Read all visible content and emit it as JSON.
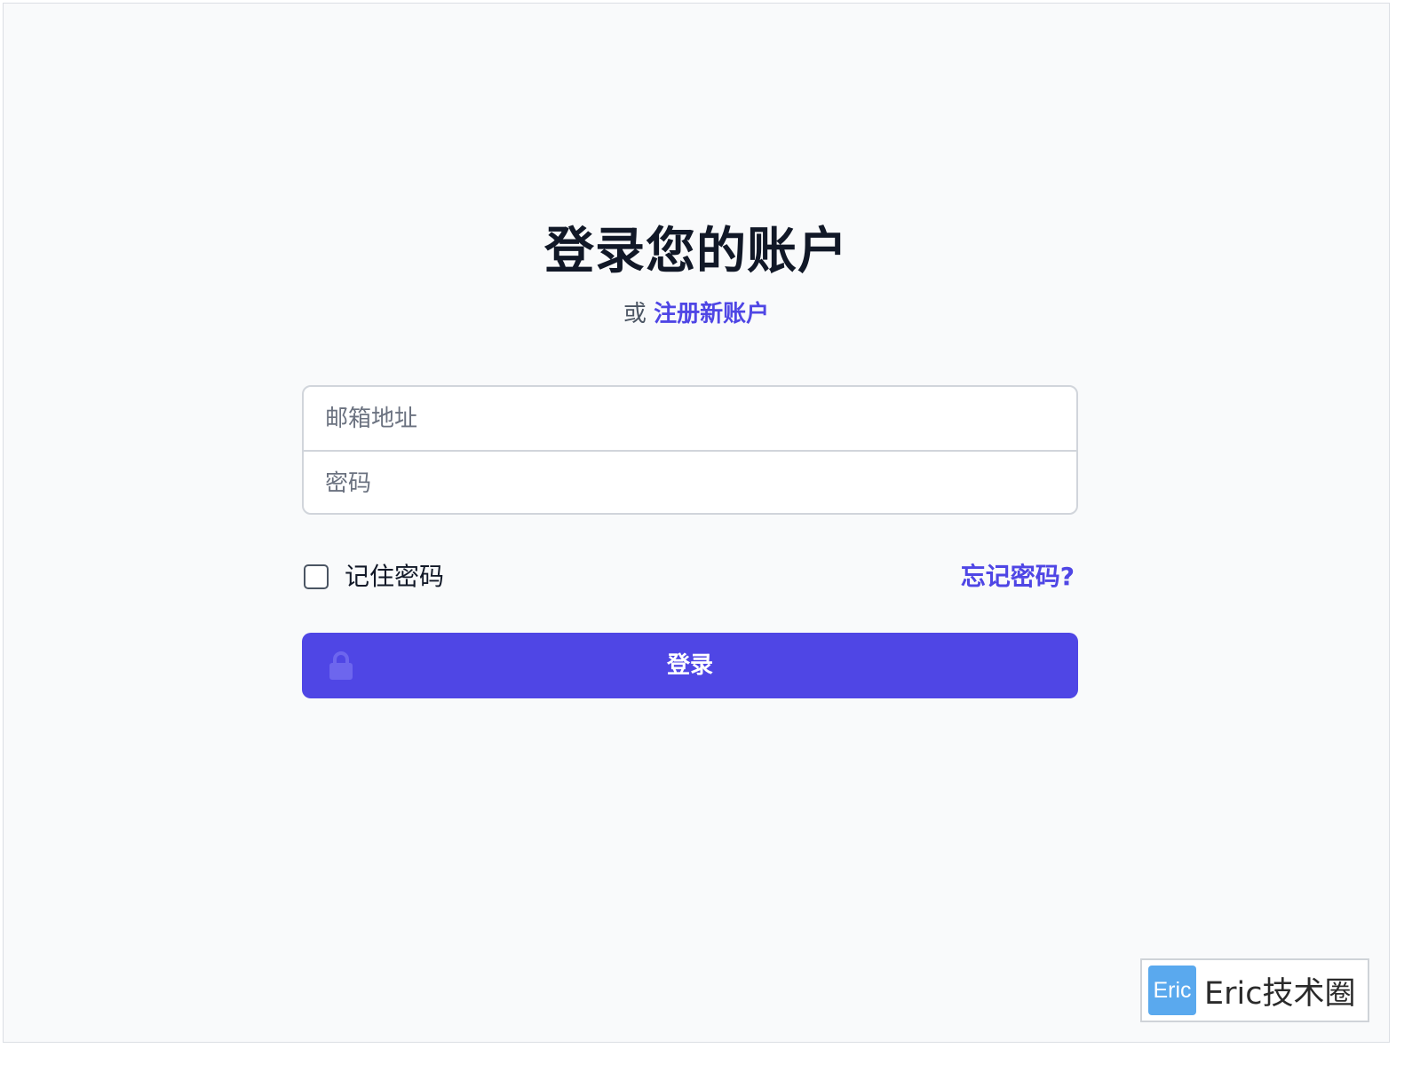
{
  "header": {
    "title": "登录您的账户",
    "subtitle_prefix": "或",
    "register_link": "注册新账户"
  },
  "form": {
    "email": {
      "value": "",
      "placeholder": "邮箱地址"
    },
    "password": {
      "value": "",
      "placeholder": "密码"
    },
    "remember_label": "记住密码",
    "remember_checked": false,
    "forgot_link": "忘记密码?",
    "submit_label": "登录",
    "submit_icon": "lock-icon"
  },
  "watermark": {
    "logo_text": "Eric",
    "text": "Eric技术圈"
  },
  "colors": {
    "accent": "#4f46e5",
    "background": "#f9fafb",
    "title": "#111827",
    "watermark_logo": "#5aa9ee"
  }
}
